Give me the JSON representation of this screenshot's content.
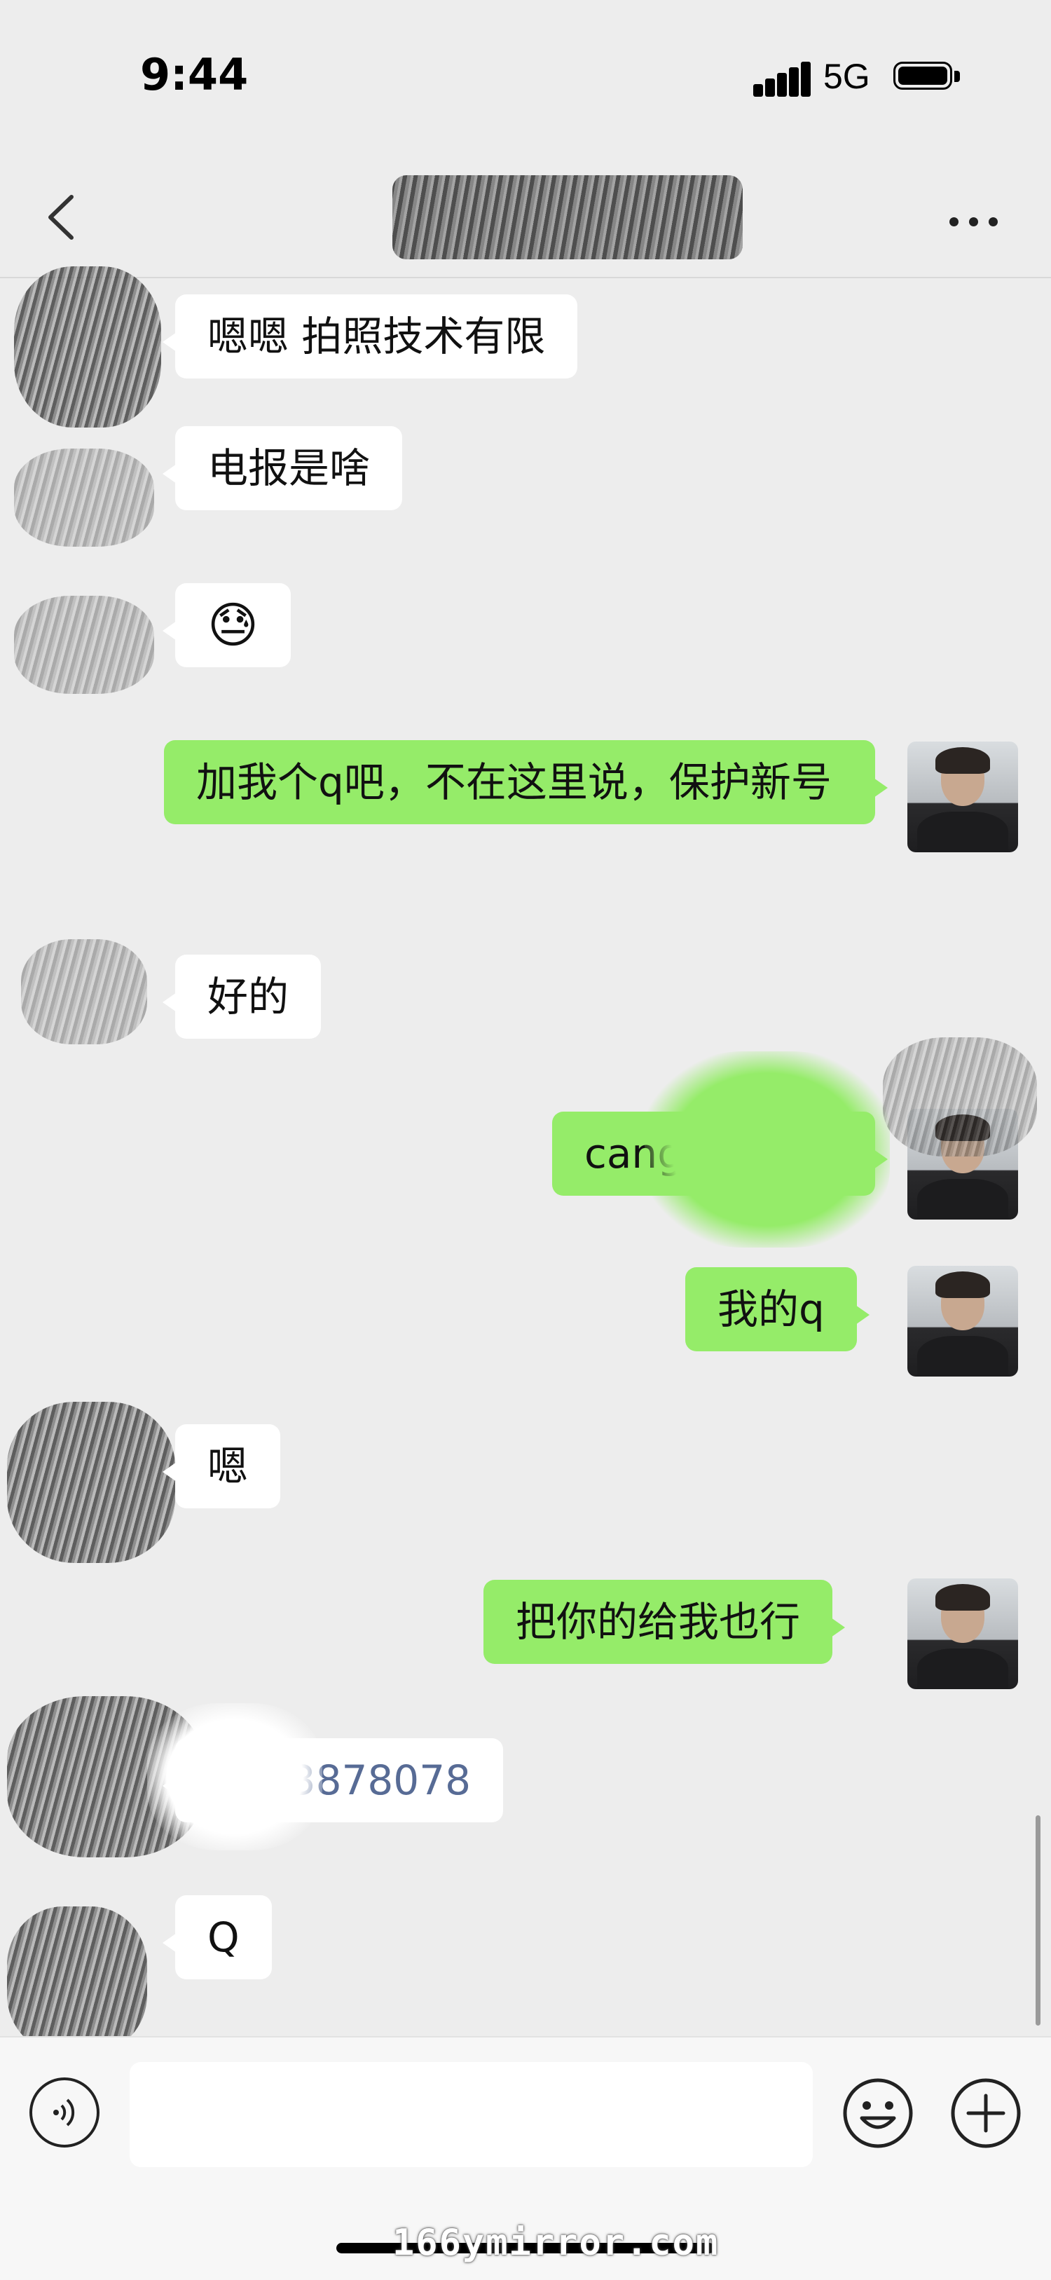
{
  "status_bar": {
    "time": "9:44",
    "network": "5G"
  },
  "nav": {
    "title": "",
    "back_icon": "chevron-left-icon",
    "more_icon": "more-dots-icon"
  },
  "messages": [
    {
      "side": "in",
      "text": "嗯嗯 拍照技术有限"
    },
    {
      "side": "in",
      "text": "电报是啥"
    },
    {
      "side": "in",
      "text": "😓"
    },
    {
      "side": "out",
      "text": "加我个q吧，不在这里说，保护新号"
    },
    {
      "side": "in",
      "text": "好的"
    },
    {
      "side": "out",
      "text": "cangge"
    },
    {
      "side": "out",
      "text": "我的q"
    },
    {
      "side": "in",
      "text": "嗯"
    },
    {
      "side": "out",
      "text": "把你的给我也行"
    },
    {
      "side": "in",
      "text": "3878078"
    },
    {
      "side": "in",
      "text": "Q"
    }
  ],
  "input_bar": {
    "placeholder": "",
    "voice_icon": "voice-icon",
    "emoji_icon": "smiley-icon",
    "add_icon": "plus-icon"
  },
  "watermark": "166ymirror.com",
  "colors": {
    "background": "#ededed",
    "outgoing_bubble": "#95ec69",
    "incoming_bubble": "#ffffff",
    "link": "#576b95"
  }
}
